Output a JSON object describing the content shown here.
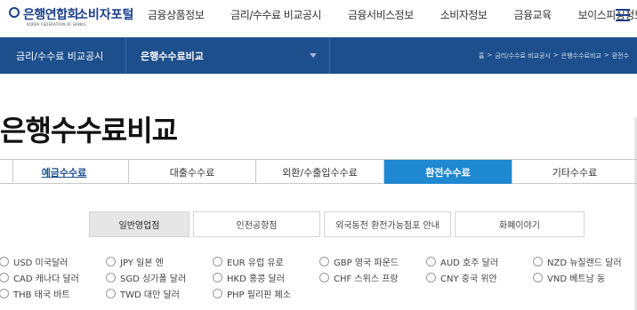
{
  "header": {
    "logo_main": "은행연합회",
    "logo_sub": "KOREA FEDERATION OF BANKS",
    "logo_portal": "소비자포털",
    "nav": [
      "금융상품정보",
      "금리/수수료 비교공시",
      "금융서비스정보",
      "소비자정보",
      "금융교육",
      "보이스피싱정보"
    ]
  },
  "bluebar": {
    "section": "금리/수수료 비교공시",
    "current": "은행수수료비교",
    "breadcrumb": [
      "홈",
      ">",
      "금리/수수료 비교공시",
      ">",
      "은행수수료비교",
      ">",
      "환전수"
    ]
  },
  "page_title": "은행수수료비교",
  "tabs": [
    "예금수수료",
    "대출수수료",
    "외환/수출입수수료",
    "환전수수료",
    "기타수수료"
  ],
  "subtabs": [
    "일반영업점",
    "인천공항점",
    "외국동전 환전가능점포 안내",
    "화폐이야기"
  ],
  "currencies": [
    [
      "USD 미국달러",
      "JPY 일본 엔",
      "EUR 유럽 유로",
      "GBP 영국 파운드",
      "AUD 호주 달러",
      "NZD 뉴질랜드 달러"
    ],
    [
      "CAD 캐나다 달러",
      "SGD 싱가폴 달러",
      "HKD 홍콩 달러",
      "CHF 스위스 프랑",
      "CNY 중국 위안",
      "VND 베트남 동"
    ],
    [
      "THB 태국 바트",
      "TWD 대만 달러",
      "PHP 필리핀 페소"
    ]
  ],
  "colors": {
    "brand": "#1b3f8b",
    "bluebar": "#1d4f8d",
    "active_tab": "#1e88d0"
  }
}
